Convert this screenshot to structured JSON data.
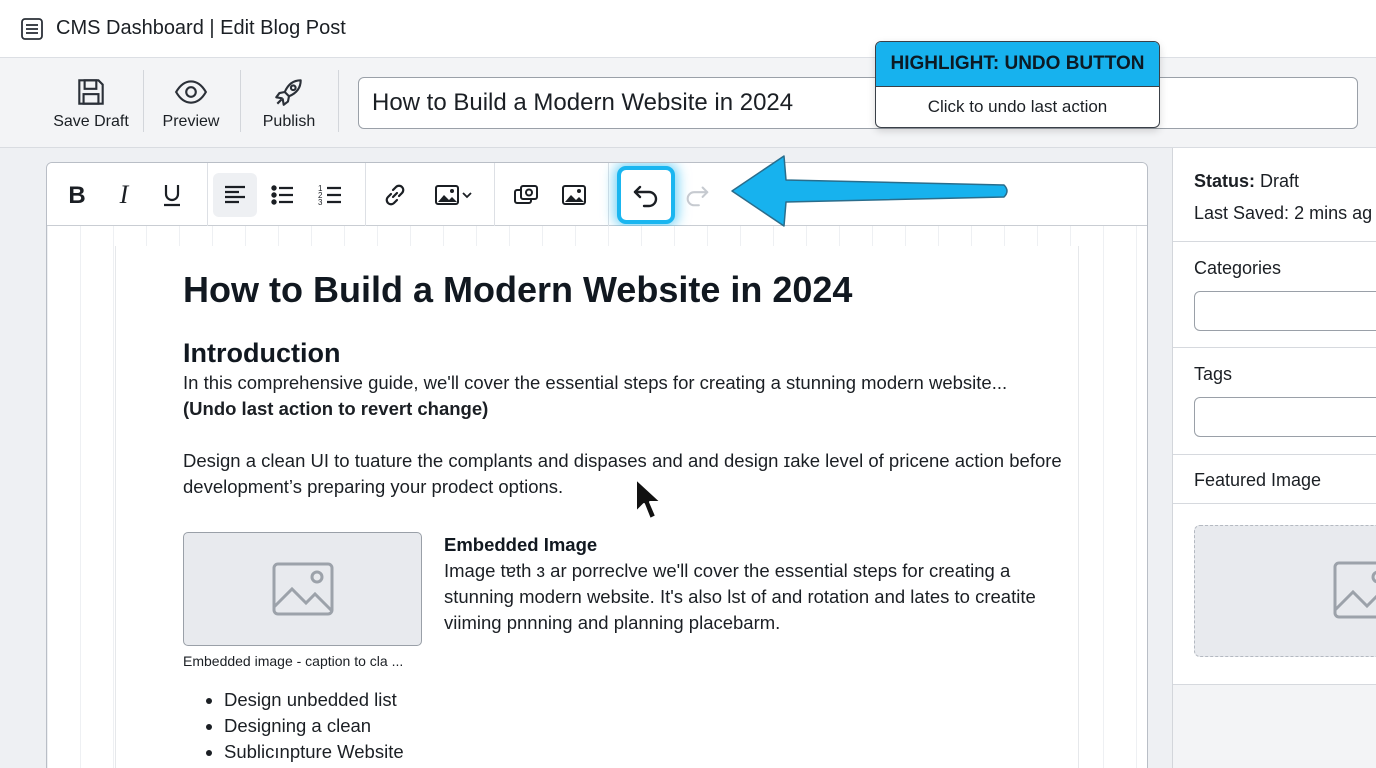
{
  "window": {
    "title": "CMS Dashboard |  Edit Blog Post"
  },
  "toolbar": {
    "save_label": "Save Draft",
    "preview_label": "Preview",
    "publish_label": "Publish",
    "post_title_value": "How to Build a Modern Website in 2024"
  },
  "callout": {
    "heading": "HIGHLIGHT: UNDO BUTTON",
    "text": "Click to undo last action"
  },
  "format_toolbar": {
    "buttons": [
      "bold",
      "italic",
      "underline",
      "align-left",
      "bullet-list",
      "numbered-list",
      "link",
      "image-dropdown",
      "media",
      "image",
      "undo",
      "redo"
    ],
    "active": "align-left",
    "highlighted": "undo",
    "highlight_color": "#1ab6f0"
  },
  "document": {
    "title": "How to Build a Modern Website in 2024",
    "intro_heading": "Introduction",
    "intro_text": "In this comprehensive guide, we'll cover the essential steps for creating a stunning modern website...",
    "undo_note": "(Undo last action to revert change)",
    "paragraph2": "Design a clean UI to tuature the complants and dispases and and design ɪake level of pricene action before development’s preparing your prodect options.",
    "embed": {
      "heading": "Embedded Image",
      "text": "Image tɐth ɜ ar porreclve we'll cover the essential steps for creating a stunning modern website. It's also lst of and rotation and lates to creatite viiming pnnning and planning placebarm.",
      "caption": "Embedded image - caption to cla ..."
    },
    "bullets": [
      "Design unbedded list",
      "Designing a clean",
      "Sublicınpture Website"
    ]
  },
  "sidebar": {
    "status_label": "Status:",
    "status_value": "Draft",
    "last_saved": "Last Saved: 2 mins ag",
    "categories_label": "Categories",
    "tags_label": "Tags",
    "featured_label": "Featured Image"
  }
}
